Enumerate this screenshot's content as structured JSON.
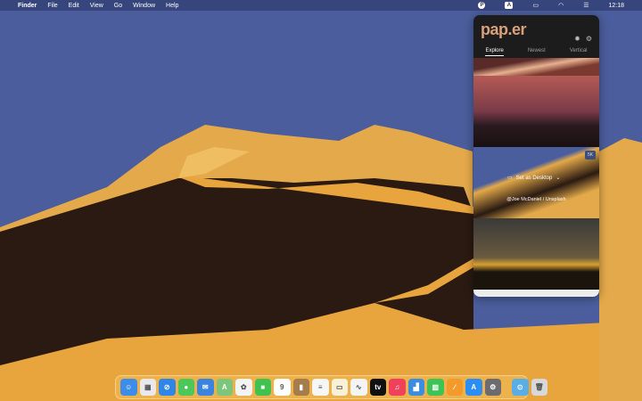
{
  "menubar": {
    "apple": "",
    "items": [
      "Finder",
      "File",
      "Edit",
      "View",
      "Go",
      "Window",
      "Help"
    ],
    "clock": "12:18",
    "input_source": "A",
    "status_icons": [
      "paper-icon",
      "input-source-icon",
      "battery-icon",
      "wifi-icon",
      "control-center-icon"
    ]
  },
  "popover": {
    "logo": "pap.er",
    "tabs": [
      "Explore",
      "Newest",
      "Vertical"
    ],
    "active_tab": "Explore",
    "set_desktop": "Set as Desktop",
    "credit": "@Joe McDaniel / Unsplash",
    "badge": "5K"
  },
  "dock": {
    "apps": [
      {
        "name": "finder",
        "glyph": "☺",
        "color": "#3d8de8"
      },
      {
        "name": "launchpad",
        "glyph": "▦",
        "color": "#e8e8ee"
      },
      {
        "name": "safari",
        "glyph": "⊘",
        "color": "#2f86e6"
      },
      {
        "name": "messages",
        "glyph": "●",
        "color": "#4cc85a"
      },
      {
        "name": "mail",
        "glyph": "✉",
        "color": "#3a84e0"
      },
      {
        "name": "maps",
        "glyph": "A",
        "color": "#7bc67a"
      },
      {
        "name": "photos",
        "glyph": "✿",
        "color": "#f4f4f4"
      },
      {
        "name": "facetime",
        "glyph": "■",
        "color": "#41c150"
      },
      {
        "name": "calendar",
        "glyph": "9",
        "color": "#ffffff"
      },
      {
        "name": "contacts",
        "glyph": "▮",
        "color": "#a57d4c"
      },
      {
        "name": "reminders",
        "glyph": "≡",
        "color": "#f6f6f6"
      },
      {
        "name": "notes",
        "glyph": "▭",
        "color": "#f8f1d6"
      },
      {
        "name": "freeform",
        "glyph": "∿",
        "color": "#f4f4f4"
      },
      {
        "name": "tv",
        "glyph": "tv",
        "color": "#111111"
      },
      {
        "name": "music",
        "glyph": "♫",
        "color": "#f0405a"
      },
      {
        "name": "keynote",
        "glyph": "▟",
        "color": "#3a8de0"
      },
      {
        "name": "numbers",
        "glyph": "▥",
        "color": "#3cc456"
      },
      {
        "name": "pages",
        "glyph": "∕",
        "color": "#f39a2a"
      },
      {
        "name": "app-store",
        "glyph": "A",
        "color": "#2c8ef2"
      },
      {
        "name": "system-settings",
        "glyph": "⚙",
        "color": "#6c6c70"
      }
    ],
    "extras": [
      {
        "name": "downloads-folder",
        "glyph": "⊙",
        "color": "#5aaee6"
      },
      {
        "name": "trash",
        "glyph": "🗑",
        "color": "#d8d8d8"
      }
    ]
  }
}
